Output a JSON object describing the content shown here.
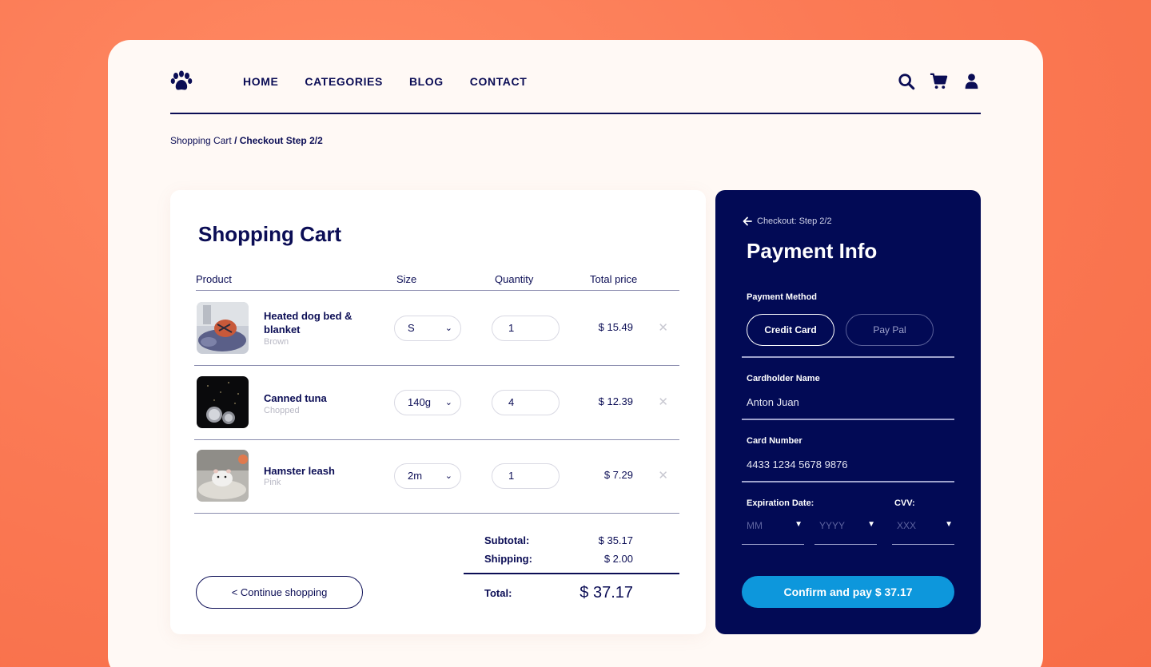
{
  "nav": {
    "items": [
      "HOME",
      "CATEGORIES",
      "BLOG",
      "CONTACT"
    ]
  },
  "icons": {
    "logo": "paw-icon",
    "search": "search-icon",
    "cart": "cart-icon",
    "user": "user-icon"
  },
  "breadcrumb": {
    "first": "Shopping Cart",
    "current": "/ Checkout Step 2/2"
  },
  "cart": {
    "title": "Shopping Cart",
    "headers": {
      "product": "Product",
      "size": "Size",
      "quantity": "Quantity",
      "total": "Total price"
    },
    "items": [
      {
        "name": "Heated dog bed & blanket",
        "variant": "Brown",
        "size": "S",
        "qty": "1",
        "price": "$ 15.49"
      },
      {
        "name": "Canned tuna",
        "variant": "Chopped",
        "size": "140g",
        "qty": "4",
        "price": "$ 12.39"
      },
      {
        "name": "Hamster leash",
        "variant": "Pink",
        "size": "2m",
        "qty": "1",
        "price": "$ 7.29"
      }
    ],
    "subtotal_label": "Subtotal:",
    "subtotal_value": "$ 35.17",
    "shipping_label": "Shipping:",
    "shipping_value": "$ 2.00",
    "total_label": "Total:",
    "total_value": "$ 37.17",
    "continue_label": "< Continue shopping"
  },
  "payment": {
    "back_label": "Checkout: Step 2/2",
    "title": "Payment Info",
    "method_label": "Payment Method",
    "methods": [
      "Credit Card",
      "Pay Pal"
    ],
    "selected_method": "Credit Card",
    "cardholder_label": "Cardholder Name",
    "cardholder_value": "Anton Juan",
    "card_number_label": "Card Number",
    "card_number_value": "4433 1234 5678 9876",
    "expiration_label": "Expiration Date:",
    "cvv_label": "CVV:",
    "month_placeholder": "MM",
    "year_placeholder": "YYYY",
    "cvv_placeholder": "XXX",
    "confirm_label": "Confirm and pay $ 37.17"
  },
  "colors": {
    "background": "#f97450",
    "navy": "#020a55",
    "accent": "#0d97dc",
    "card_bg": "#fff9f5"
  }
}
